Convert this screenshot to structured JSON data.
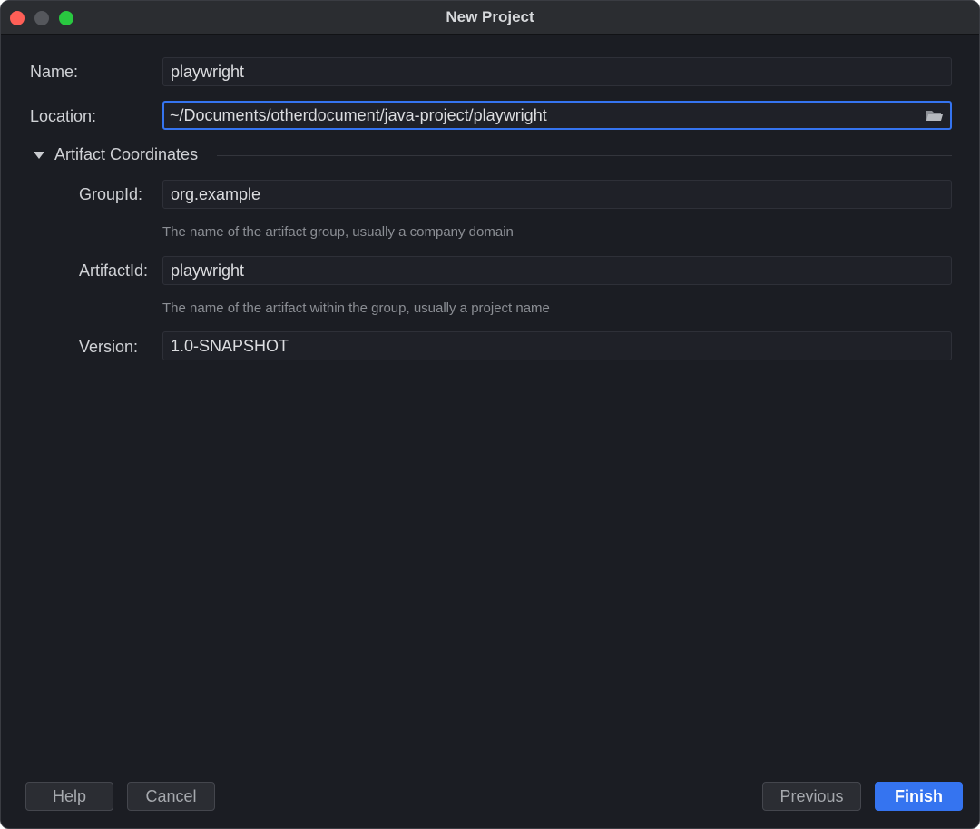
{
  "window": {
    "title": "New Project"
  },
  "form": {
    "name": {
      "label": "Name:",
      "value": "playwright"
    },
    "location": {
      "label": "Location:",
      "value": "~/Documents/otherdocument/java-project/playwright",
      "icon": "folder-icon"
    },
    "artifact_section": {
      "label": "Artifact Coordinates",
      "expanded": true
    },
    "group_id": {
      "label": "GroupId:",
      "value": "org.example",
      "hint": "The name of the artifact group, usually a company domain"
    },
    "artifact_id": {
      "label": "ArtifactId:",
      "value": "playwright",
      "hint": "The name of the artifact within the group, usually a project name"
    },
    "version": {
      "label": "Version:",
      "value": "1.0-SNAPSHOT"
    }
  },
  "buttons": {
    "help": "Help",
    "cancel": "Cancel",
    "previous": "Previous",
    "finish": "Finish"
  },
  "colors": {
    "accent": "#3574f0",
    "background": "#1b1d23",
    "close": "#fe5f57",
    "minimize": "#55575c",
    "maximize": "#29c840"
  }
}
